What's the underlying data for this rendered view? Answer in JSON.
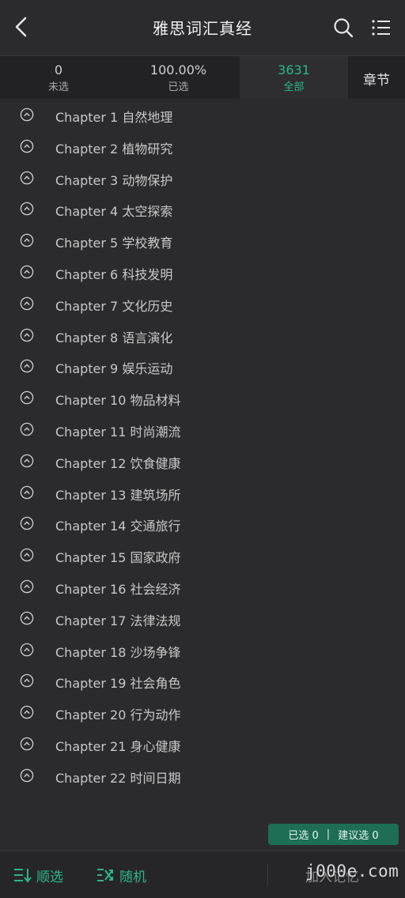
{
  "header": {
    "title": "雅思词汇真经",
    "back_icon": "chevron-left-icon",
    "search_icon": "search-icon",
    "menu_icon": "list-menu-icon"
  },
  "tabs": [
    {
      "value": "0",
      "label": "未选"
    },
    {
      "value": "100.00%",
      "label": "已选"
    },
    {
      "value": "3631",
      "label": "全部",
      "active": true
    },
    {
      "label": "章节"
    }
  ],
  "chapters": [
    "Chapter 1 自然地理",
    "Chapter 2 植物研究",
    "Chapter 3 动物保护",
    "Chapter 4 太空探索",
    "Chapter 5 学校教育",
    "Chapter 6 科技发明",
    "Chapter 7 文化历史",
    "Chapter 8 语言演化",
    "Chapter 9 娱乐运动",
    "Chapter 10 物品材料",
    "Chapter 11 时尚潮流",
    "Chapter 12 饮食健康",
    "Chapter 13 建筑场所",
    "Chapter 14 交通旅行",
    "Chapter 15 国家政府",
    "Chapter 16 社会经济",
    "Chapter 17 法律法规",
    "Chapter 18 沙场争锋",
    "Chapter 19 社会角色",
    "Chapter 20 行为动作",
    "Chapter 21 身心健康",
    "Chapter 22 时间日期"
  ],
  "chapter_icon": "chevron-up-circle-icon",
  "selection_badge": {
    "selected": "已选 0",
    "separator": "|",
    "suggested": "建议选 0"
  },
  "bottom_bar": {
    "sequential": {
      "label": "顺选",
      "icon": "sort-down-icon"
    },
    "random": {
      "label": "随机",
      "icon": "shuffle-icon"
    },
    "add_label": "加入记忆",
    "watermark": "j000e.com"
  },
  "colors": {
    "background": "#2b2b2d",
    "accent": "#2bb68a",
    "badge_bg": "#1d6e55"
  }
}
